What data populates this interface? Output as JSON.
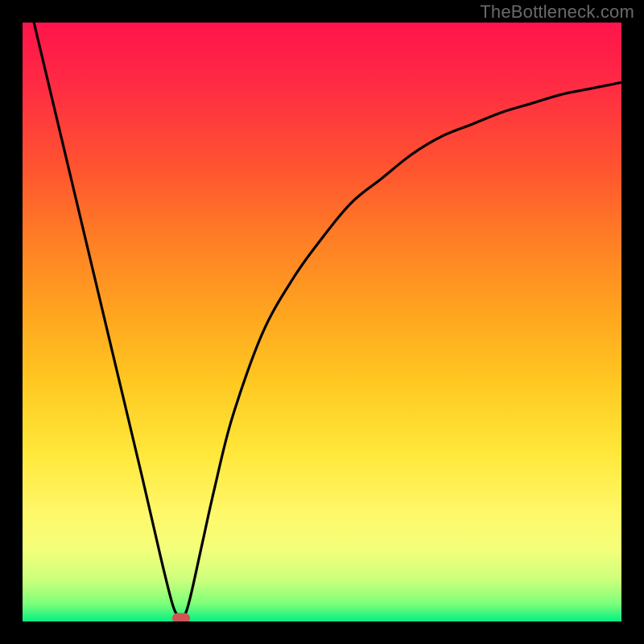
{
  "watermark": "TheBottleneck.com",
  "chart_data": {
    "type": "line",
    "title": "",
    "xlabel": "",
    "ylabel": "",
    "xlim": [
      0,
      100
    ],
    "ylim": [
      0,
      100
    ],
    "grid": false,
    "legend": false,
    "background": "red-yellow-green vertical gradient",
    "series": [
      {
        "name": "curve",
        "color": "#000000",
        "x": [
          0,
          5,
          10,
          15,
          20,
          23,
          25,
          26,
          27,
          28,
          30,
          32,
          35,
          40,
          45,
          50,
          55,
          60,
          65,
          70,
          75,
          80,
          85,
          90,
          95,
          100
        ],
        "y": [
          108,
          87,
          66,
          45,
          24,
          11,
          3,
          1,
          1,
          4,
          13,
          22,
          34,
          48,
          57,
          64,
          70,
          74,
          78,
          81,
          83,
          85,
          86.5,
          88,
          89,
          90
        ]
      }
    ],
    "marker": {
      "x": 26.5,
      "y": 0.5,
      "color": "#cf5552"
    }
  }
}
